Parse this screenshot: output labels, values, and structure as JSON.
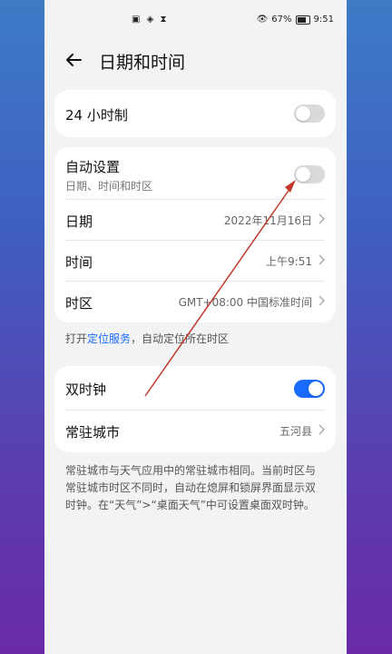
{
  "statusbar": {
    "left_icons": "▣ ◈ ⧗",
    "battery_pct": "67%",
    "time": "9:51"
  },
  "header": {
    "title": "日期和时间"
  },
  "card1": {
    "label": "24 小时制",
    "toggle_on": false
  },
  "card2": {
    "auto_label": "自动设置",
    "auto_sub": "日期、时间和时区",
    "auto_on": false,
    "date_label": "日期",
    "date_value": "2022年11月16日",
    "time_label": "时间",
    "time_value": "上午9:51",
    "tz_label": "时区",
    "tz_value": "GMT+08:00 中国标准时间"
  },
  "note1": {
    "prefix": "打开",
    "link": "定位服务",
    "suffix": "，自动定位所在时区"
  },
  "card3": {
    "dual_label": "双时钟",
    "dual_on": true,
    "city_label": "常驻城市",
    "city_value": "五河县"
  },
  "note2": "常驻城市与天气应用中的常驻城市相同。当前时区与常驻城市时区不同时，自动在熄屏和锁屏界面显示双时钟。在“天气”>“桌面天气”中可设置桌面双时钟。",
  "colors": {
    "accent": "#1a6bff",
    "annotation_arrow": "#c0392b"
  }
}
